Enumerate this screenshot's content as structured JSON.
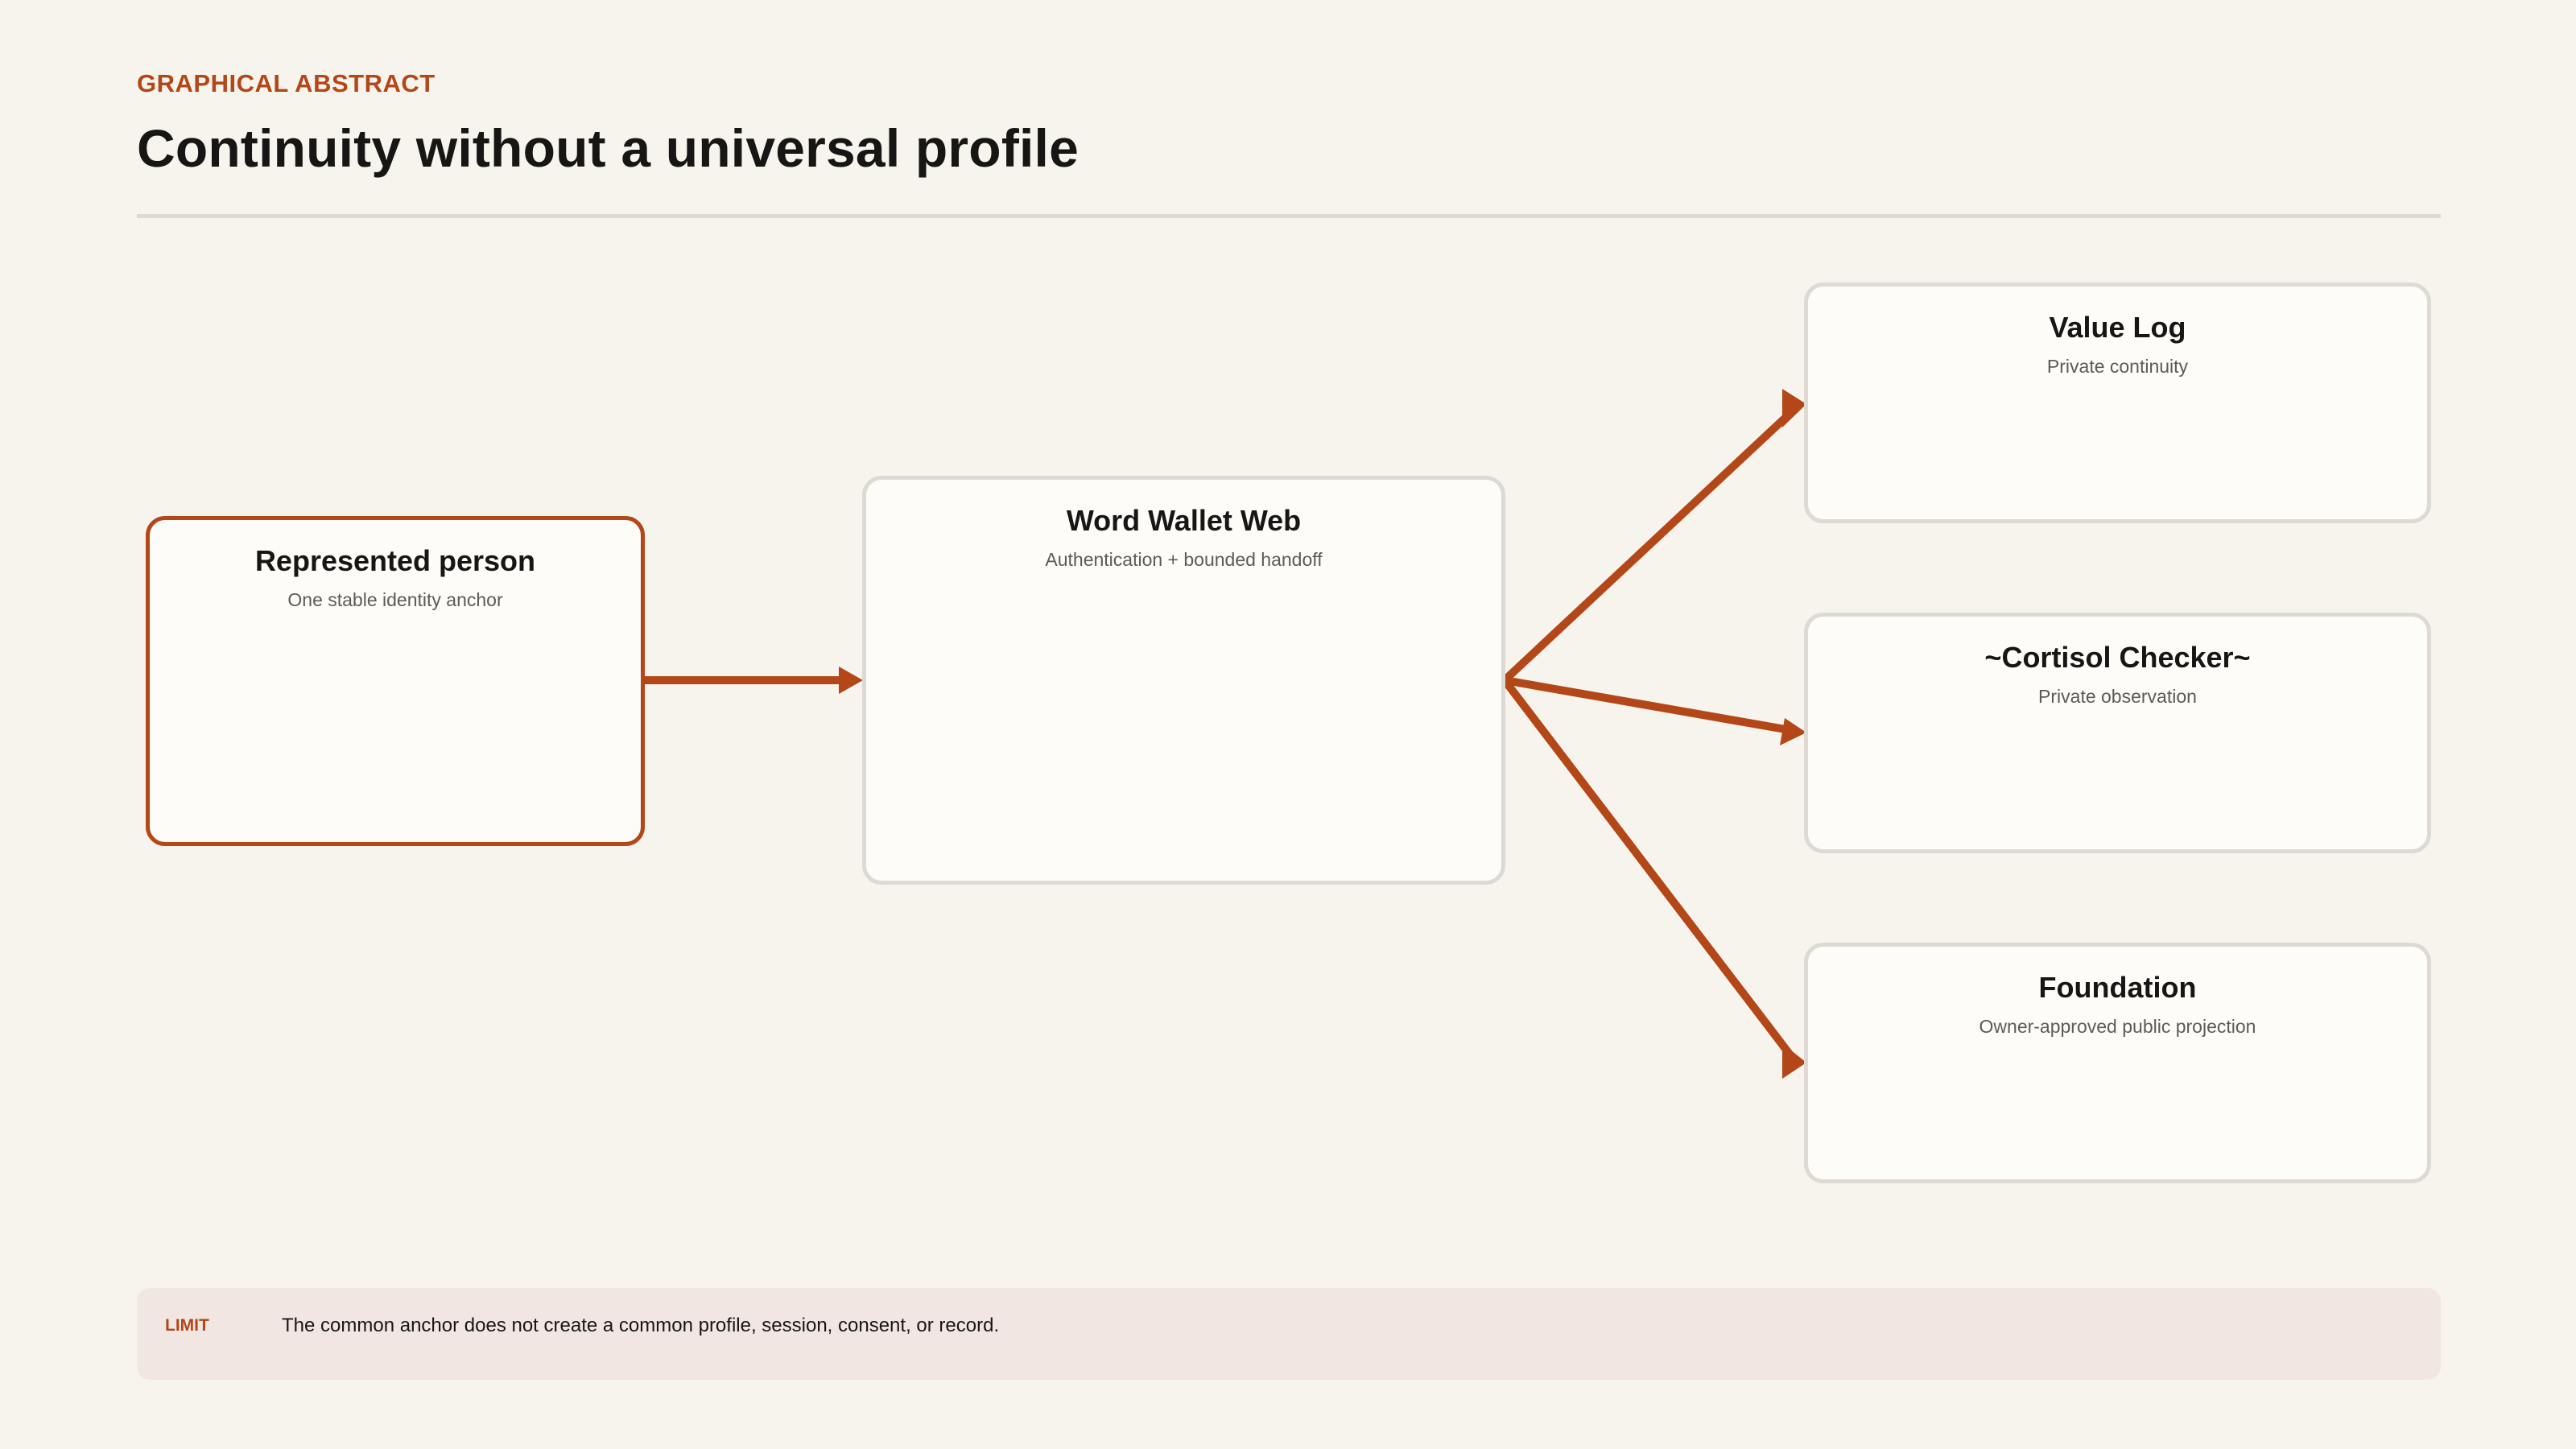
{
  "header": {
    "eyebrow": "GRAPHICAL ABSTRACT",
    "title": "Continuity without a universal profile"
  },
  "nodes": {
    "person": {
      "title": "Represented person",
      "subtitle": "One stable identity anchor"
    },
    "wallet": {
      "title": "Word Wallet Web",
      "subtitle": "Authentication + bounded handoff"
    },
    "value_log": {
      "title": "Value Log",
      "subtitle": "Private continuity"
    },
    "cortisol": {
      "title": "~Cortisol Checker~",
      "subtitle": "Private observation"
    },
    "foundation": {
      "title": "Foundation",
      "subtitle": "Owner-approved public projection"
    }
  },
  "edges": [
    {
      "from": "Represented person",
      "to": "Word Wallet Web"
    },
    {
      "from": "Word Wallet Web",
      "to": "Value Log"
    },
    {
      "from": "Word Wallet Web",
      "to": "~Cortisol Checker~"
    },
    {
      "from": "Word Wallet Web",
      "to": "Foundation"
    }
  ],
  "limit": {
    "label": "LIMIT",
    "text": "The common anchor does not create a common profile, session, consent, or record."
  },
  "colors": {
    "accent": "#b34718",
    "background": "#f7f4ee",
    "card": "#fdfcf8",
    "card_border": "#dedad3",
    "limit_bg": "#f2e6e2"
  }
}
